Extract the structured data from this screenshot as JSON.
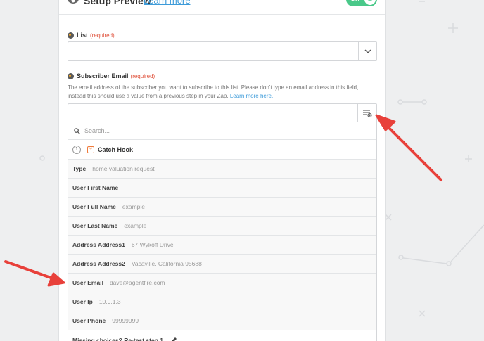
{
  "header": {
    "title": "Setup Preview",
    "link": "Learn more",
    "toggle_label": "ON"
  },
  "list_field": {
    "label": "List",
    "required": "(required)",
    "value": ""
  },
  "email_field": {
    "label": "Subscriber Email",
    "required": "(required)",
    "help": "The email address of the subscriber you want to subscribe to this list. Please don't type an email address in this field, instead this should use a value from a previous step in your Zap.",
    "help_link": "Learn more here.",
    "value": ""
  },
  "dropdown": {
    "search_placeholder": "Search...",
    "step": {
      "number": "1",
      "title": "Catch Hook"
    },
    "options": [
      {
        "key": "Type",
        "value": "home valuation request"
      },
      {
        "key": "User First Name",
        "value": ""
      },
      {
        "key": "User Full Name",
        "value": "example"
      },
      {
        "key": "User Last Name",
        "value": "example"
      },
      {
        "key": "Address Address1",
        "value": "67 Wykoff Drive"
      },
      {
        "key": "Address Address2",
        "value": "Vacaville, California 95688"
      },
      {
        "key": "User Email",
        "value": "dave@agentfire.com"
      },
      {
        "key": "User Ip",
        "value": "10.0.1.3"
      },
      {
        "key": "User Phone",
        "value": "99999999"
      }
    ],
    "footer": "Missing choices? Re-test step 1."
  },
  "colors": {
    "toggle": "#49c889",
    "link": "#3d9bd9",
    "required": "#e0533d",
    "annotation_arrow": "#e8403a"
  },
  "icons": [
    "eye-icon",
    "app-icon",
    "chevron-down-icon",
    "insert-field-icon",
    "search-icon",
    "catch-hook-icon",
    "pencil-icon",
    "annotation-arrow-icon"
  ]
}
